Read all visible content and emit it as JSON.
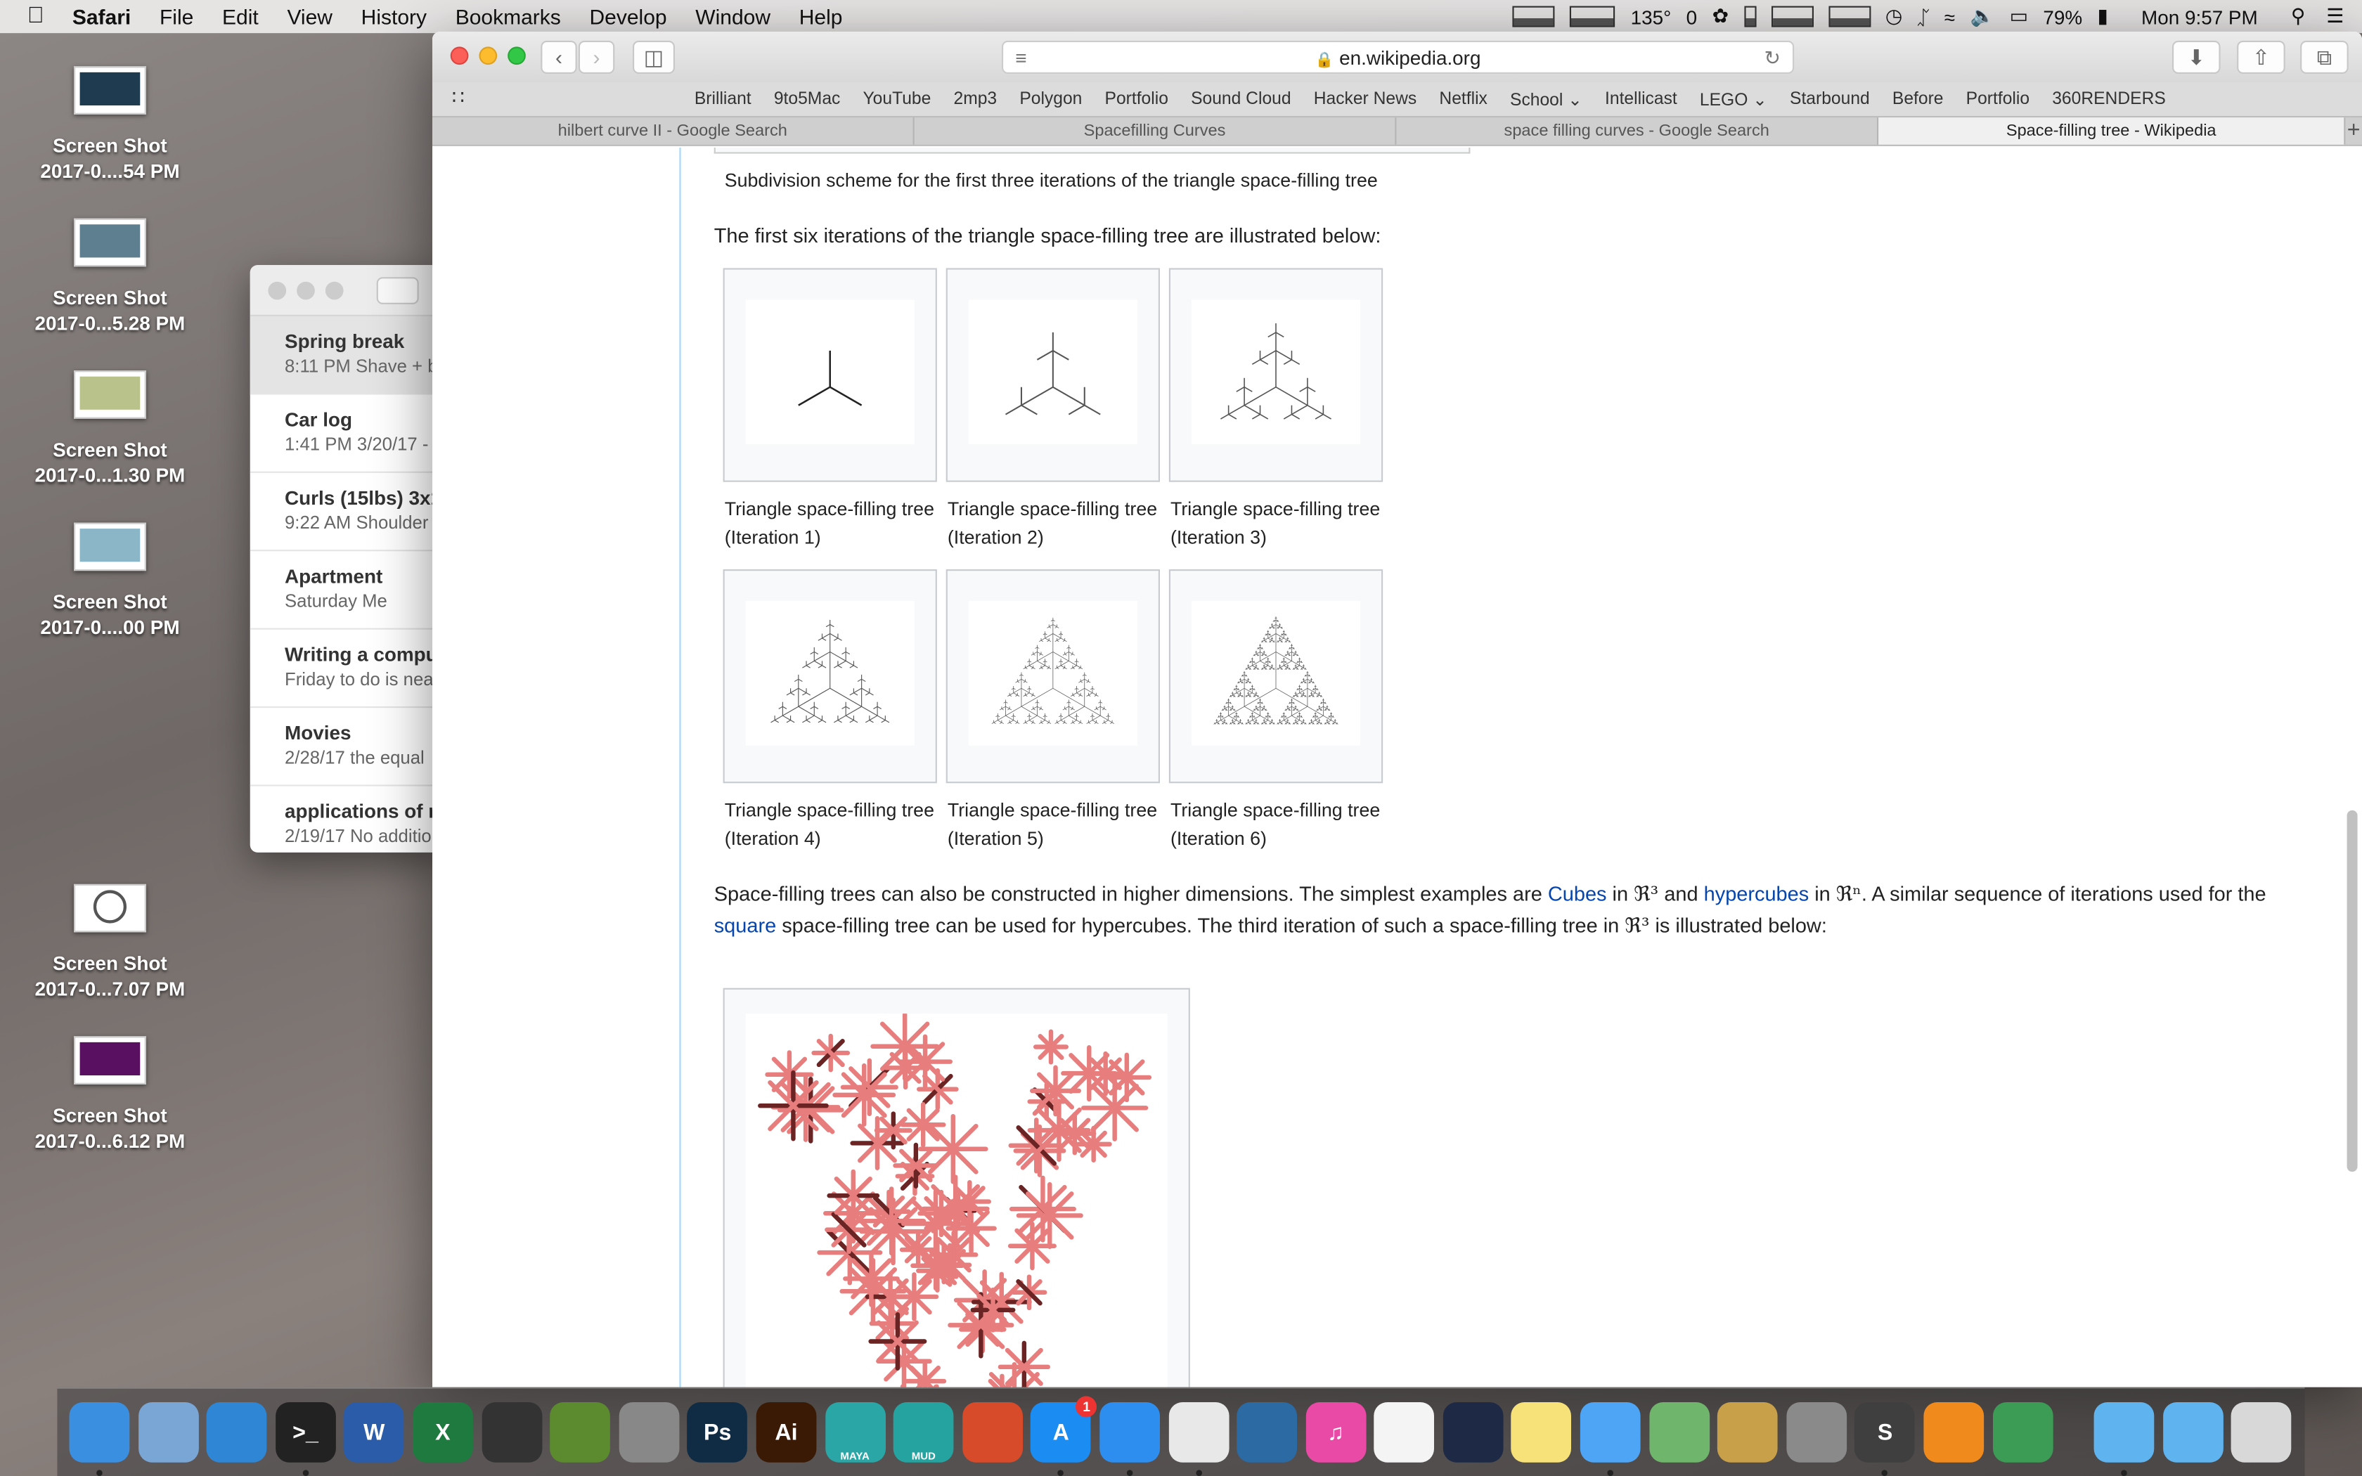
{
  "menubar": {
    "app_name": "Safari",
    "items": [
      "File",
      "Edit",
      "View",
      "History",
      "Bookmarks",
      "Develop",
      "Window",
      "Help"
    ],
    "status": {
      "temperature": "135°",
      "counter": "0",
      "battery": "79%",
      "clock": "Mon 9:57 PM"
    }
  },
  "desktop_icons": [
    {
      "line1": "Screen Shot",
      "line2": "2017-0....54 PM"
    },
    {
      "line1": "Screen Shot",
      "line2": "2017-0...5.28 PM"
    },
    {
      "line1": "Screen Shot",
      "line2": "2017-0...1.30 PM"
    },
    {
      "line1": "Screen Shot",
      "line2": "2017-0....00 PM"
    },
    {
      "line1": "Screen Shot",
      "line2": "2017-0...7.07 PM"
    },
    {
      "line1": "Screen Shot",
      "line2": "2017-0...6.12 PM"
    }
  ],
  "notes": [
    {
      "title": "Spring break",
      "meta": "8:11 PM  Shave + b"
    },
    {
      "title": "Car log",
      "meta": "1:41 PM  3/20/17 -"
    },
    {
      "title": "Curls (15lbs) 3x1",
      "meta": "9:22 AM  Shoulder"
    },
    {
      "title": "Apartment",
      "meta": "Saturday  Me"
    },
    {
      "title": "Writing a compu",
      "meta": "Friday  to do is nea"
    },
    {
      "title": "Movies",
      "meta": "2/28/17  the equal"
    },
    {
      "title": "applications of r",
      "meta": "2/19/17  No additio"
    }
  ],
  "browser": {
    "url": "en.wikipedia.org",
    "favorites": [
      "Brilliant",
      "9to5Mac",
      "YouTube",
      "2mp3",
      "Polygon",
      "Portfolio",
      "Sound Cloud",
      "Hacker News",
      "Netflix",
      "School ⌄",
      "Intellicast",
      "LEGO ⌄",
      "Starbound",
      "Before",
      "Portfolio",
      "360RENDERS"
    ],
    "tabs": [
      "hilbert curve II - Google Search",
      "Spacefilling Curves",
      "space filling curves - Google Search",
      "Space-filling tree - Wikipedia"
    ],
    "active_tab": 3
  },
  "article": {
    "top_caption": "Subdivision scheme for the first three iterations of the triangle space-filling tree",
    "intro": "The first six iterations of the triangle space-filling tree are illustrated below:",
    "gallery": [
      {
        "line1": "Triangle space-filling tree",
        "line2": "(Iteration 1)"
      },
      {
        "line1": "Triangle space-filling tree",
        "line2": "(Iteration 2)"
      },
      {
        "line1": "Triangle space-filling tree",
        "line2": "(Iteration 3)"
      },
      {
        "line1": "Triangle space-filling tree",
        "line2": "(Iteration 4)"
      },
      {
        "line1": "Triangle space-filling tree",
        "line2": "(Iteration 5)"
      },
      {
        "line1": "Triangle space-filling tree",
        "line2": "(Iteration 6)"
      }
    ],
    "para": {
      "t1": "Space-filling trees can also be constructed in higher dimensions. The simplest examples are ",
      "link1": "Cubes",
      "t2": " in ",
      "r3a": "ℜ³",
      "t3": " and ",
      "link2": "hypercubes",
      "t4": " in ",
      "rn": "ℜⁿ",
      "t5": ". A similar sequence of iterations used for the ",
      "link3": "square",
      "t6": " space-filling tree can be used for hypercubes. The third iteration of such a space-filling tree in ",
      "r3b": "ℜ³",
      "t7": " is illustrated below:"
    }
  },
  "dock": [
    {
      "name": "finder-icon",
      "label": "",
      "color": "#3b8fe0"
    },
    {
      "name": "mail-icon",
      "label": "",
      "color": "#7aa6d6"
    },
    {
      "name": "xcode-icon",
      "label": "",
      "color": "#2f86d4"
    },
    {
      "name": "terminal-icon",
      "label": ">_",
      "color": "#222"
    },
    {
      "name": "word-icon",
      "label": "W",
      "color": "#2a5caa"
    },
    {
      "name": "excel-icon",
      "label": "X",
      "color": "#1f7a3f"
    },
    {
      "name": "unity-icon",
      "label": "",
      "color": "#333"
    },
    {
      "name": "minecraft-icon",
      "label": "",
      "color": "#5c8a2f"
    },
    {
      "name": "pen-icon",
      "label": "",
      "color": "#888"
    },
    {
      "name": "photoshop-icon",
      "label": "Ps",
      "color": "#0f2c44"
    },
    {
      "name": "illustrator-icon",
      "label": "Ai",
      "color": "#3a1a05"
    },
    {
      "name": "maya-icon",
      "label": "MAYA",
      "color": "#2aa6a6"
    },
    {
      "name": "mudbox-icon",
      "label": "MUD",
      "color": "#25a3a0"
    },
    {
      "name": "maze-icon",
      "label": "",
      "color": "#d84b2a"
    },
    {
      "name": "app-store-icon",
      "label": "A",
      "color": "#1b8cf2",
      "badge": "1"
    },
    {
      "name": "safari-icon",
      "label": "",
      "color": "#2d8ef0"
    },
    {
      "name": "chrome-icon",
      "label": "",
      "color": "#e8e8e8"
    },
    {
      "name": "network-icon",
      "label": "",
      "color": "#2b6aa3"
    },
    {
      "name": "itunes-icon",
      "label": "♫",
      "color": "#e94aa6"
    },
    {
      "name": "photos-icon",
      "label": "",
      "color": "#f4f4f4"
    },
    {
      "name": "speed-icon",
      "label": "",
      "color": "#1e2a45"
    },
    {
      "name": "notes-icon",
      "label": "",
      "color": "#f7e27a"
    },
    {
      "name": "messages-icon",
      "label": "",
      "color": "#4ea5f5"
    },
    {
      "name": "maps-icon",
      "label": "",
      "color": "#6fb56b"
    },
    {
      "name": "scanner-icon",
      "label": "",
      "color": "#c8a04a"
    },
    {
      "name": "system-prefs-icon",
      "label": "",
      "color": "#8a8a8a"
    },
    {
      "name": "sublime-icon",
      "label": "S",
      "color": "#3f3f3f"
    },
    {
      "name": "vlc-icon",
      "label": "",
      "color": "#f08a1c"
    },
    {
      "name": "globe-icon",
      "label": "",
      "color": "#3c9b54"
    },
    {
      "name": "applications-folder-icon",
      "label": "",
      "color": "#5fb4f0"
    },
    {
      "name": "downloads-folder-icon",
      "label": "",
      "color": "#5fb4f0"
    },
    {
      "name": "trash-icon",
      "label": "",
      "color": "#d8d8d8"
    }
  ]
}
